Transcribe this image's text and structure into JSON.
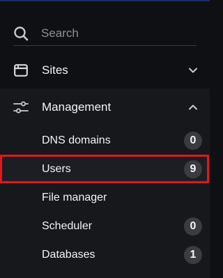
{
  "search": {
    "placeholder": "Search"
  },
  "nav": {
    "sites": {
      "label": "Sites",
      "icon": "window-icon",
      "expanded": false
    },
    "management": {
      "label": "Management",
      "icon": "sliders-icon",
      "expanded": true
    }
  },
  "management_items": [
    {
      "label": "DNS domains",
      "count": "0",
      "active": false
    },
    {
      "label": "Users",
      "count": "9",
      "active": true
    },
    {
      "label": "File manager",
      "count": "",
      "active": false
    },
    {
      "label": "Scheduler",
      "count": "0",
      "active": false
    },
    {
      "label": "Databases",
      "count": "1",
      "active": false
    }
  ],
  "colors": {
    "accent": "#3b82f6",
    "highlight": "#e3161c",
    "badge": "#3a3c42"
  }
}
